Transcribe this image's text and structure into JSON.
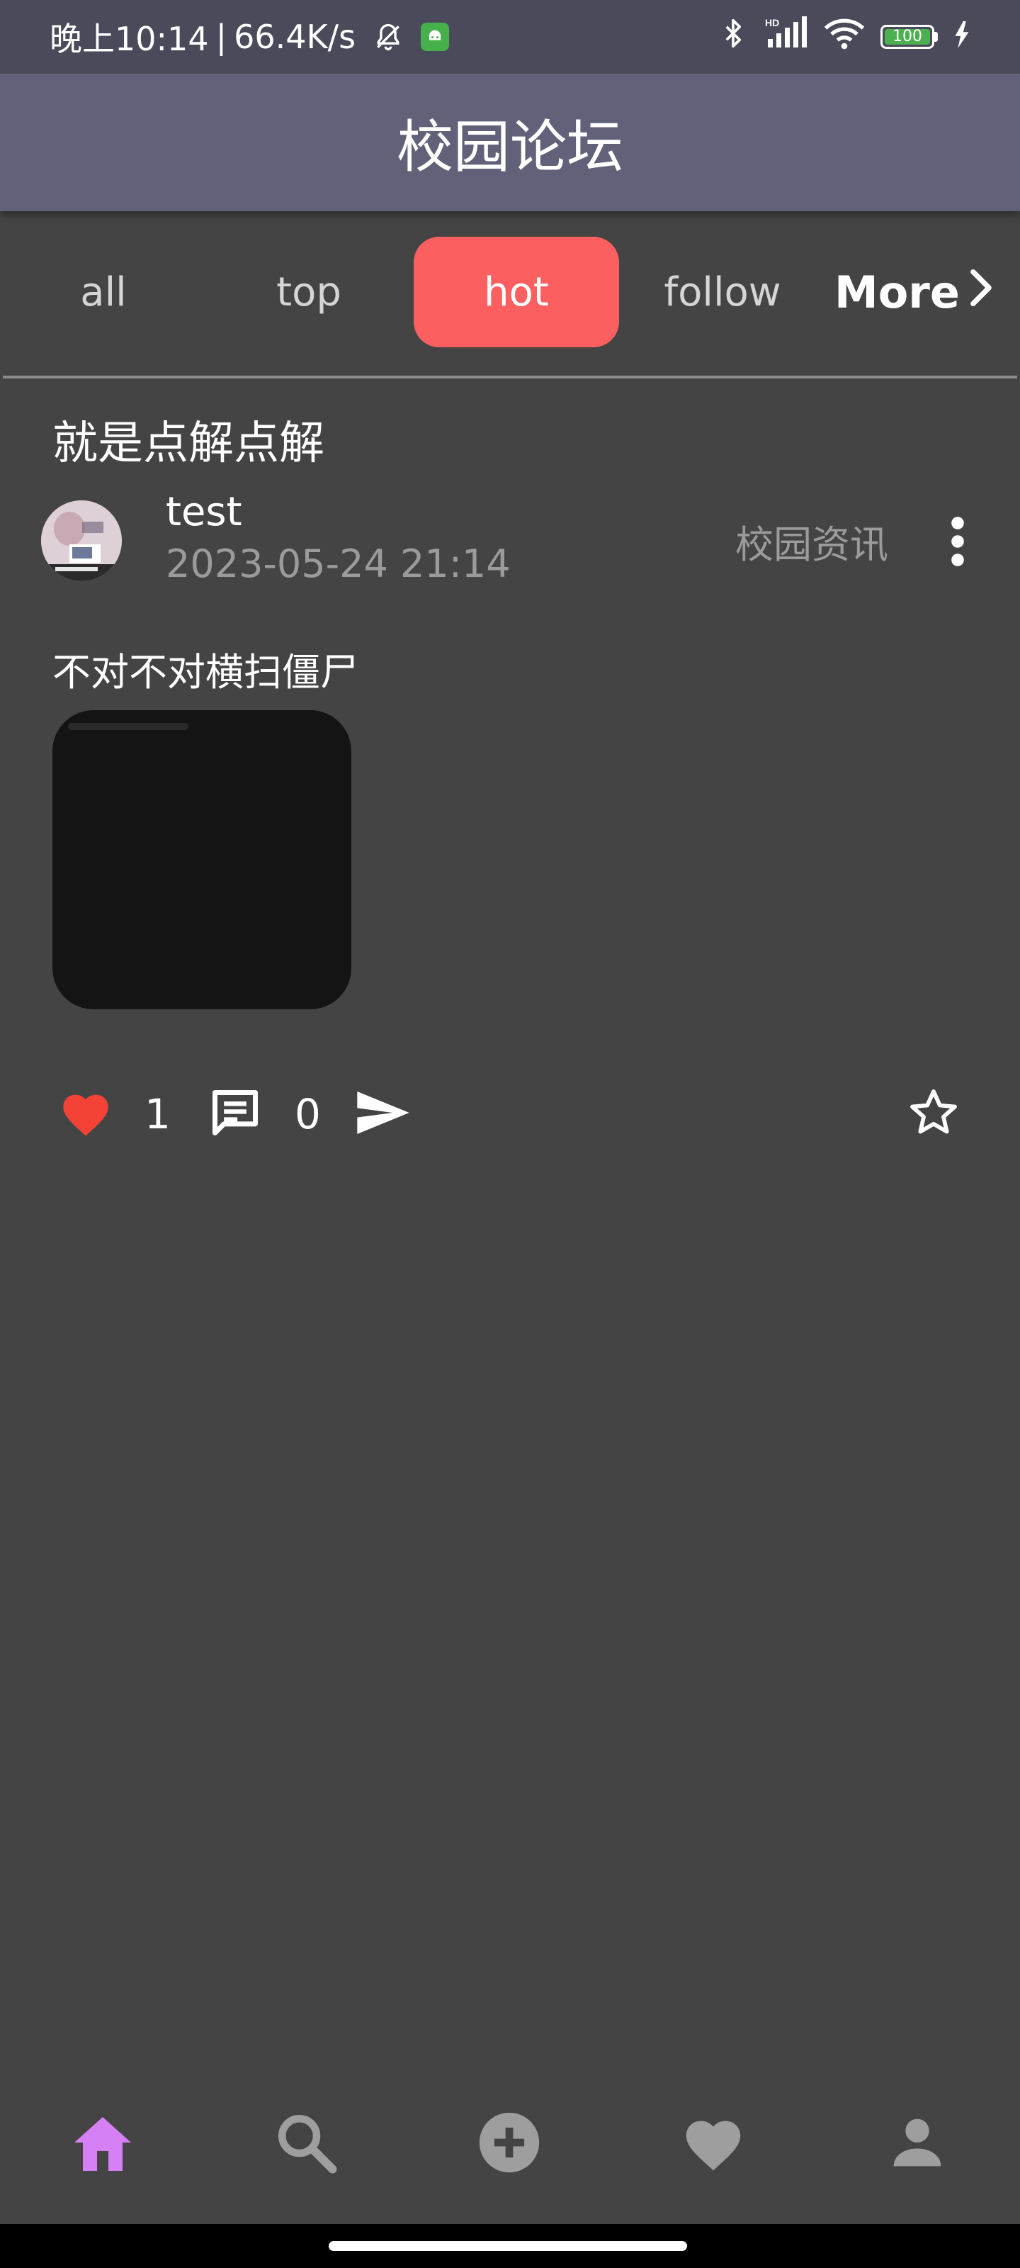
{
  "status_bar": {
    "time": "晚上10:14",
    "network_speed": "66.4K/s",
    "battery_level": "100"
  },
  "app_bar": {
    "title": "校园论坛"
  },
  "tabs": {
    "items": [
      {
        "label": "all",
        "active": false
      },
      {
        "label": "top",
        "active": false
      },
      {
        "label": "hot",
        "active": true
      },
      {
        "label": "follow",
        "active": false
      }
    ],
    "more_label": "More"
  },
  "post": {
    "title": "就是点解点解",
    "author": "test",
    "date": "2023-05-24 21:14",
    "category": "校园资讯",
    "body": "不对不对横扫僵尸",
    "likes": "1",
    "comments": "0",
    "liked": true,
    "starred": false
  },
  "bottom_nav": {
    "items": [
      {
        "icon": "home-icon",
        "active": true
      },
      {
        "icon": "search-icon",
        "active": false
      },
      {
        "icon": "add-circle-icon",
        "active": false
      },
      {
        "icon": "heart-icon",
        "active": false
      },
      {
        "icon": "person-icon",
        "active": false
      }
    ]
  },
  "colors": {
    "background": "#444444",
    "status_bar": "#4a4a5a",
    "app_bar": "#62617a",
    "active_tab": "#fc5f5f",
    "like_red": "#f44336",
    "nav_active": "#d580f5",
    "nav_inactive": "#9e9e9e"
  }
}
